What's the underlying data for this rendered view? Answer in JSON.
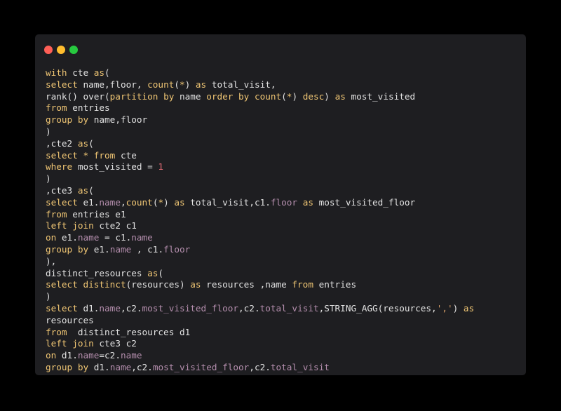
{
  "colors": {
    "background": "#000000",
    "window": "#1e1e21",
    "plain": "#e2e2e2",
    "keyword": "#f0c674",
    "property": "#b48ead",
    "string": "#d19a66",
    "number": "#e06c75",
    "dot_close": "#ff5f56",
    "dot_minimize": "#ffbd2e",
    "dot_zoom": "#27c93f"
  },
  "window_controls": [
    "close-dot",
    "minimize-dot",
    "zoom-dot"
  ],
  "code_lines": [
    [
      [
        "k",
        "with"
      ],
      [
        "p",
        " cte "
      ],
      [
        "k",
        "as"
      ],
      [
        "p",
        "("
      ]
    ],
    [
      [
        "k",
        "select"
      ],
      [
        "p",
        " name,floor, "
      ],
      [
        "k",
        "count"
      ],
      [
        "p",
        "("
      ],
      [
        "k",
        "*"
      ],
      [
        "p",
        ") "
      ],
      [
        "k",
        "as"
      ],
      [
        "p",
        " total_visit,"
      ]
    ],
    [
      [
        "p",
        "rank() over("
      ],
      [
        "k",
        "partition"
      ],
      [
        "p",
        " "
      ],
      [
        "k",
        "by"
      ],
      [
        "p",
        " name "
      ],
      [
        "k",
        "order"
      ],
      [
        "p",
        " "
      ],
      [
        "k",
        "by"
      ],
      [
        "p",
        " "
      ],
      [
        "k",
        "count"
      ],
      [
        "p",
        "("
      ],
      [
        "k",
        "*"
      ],
      [
        "p",
        ") "
      ],
      [
        "k",
        "desc"
      ],
      [
        "p",
        ") "
      ],
      [
        "k",
        "as"
      ],
      [
        "p",
        " most_visited"
      ]
    ],
    [
      [
        "k",
        "from"
      ],
      [
        "p",
        " entries"
      ]
    ],
    [
      [
        "k",
        "group"
      ],
      [
        "p",
        " "
      ],
      [
        "k",
        "by"
      ],
      [
        "p",
        " name,floor"
      ]
    ],
    [
      [
        "p",
        ")"
      ]
    ],
    [
      [
        "p",
        ",cte2 "
      ],
      [
        "k",
        "as"
      ],
      [
        "p",
        "("
      ]
    ],
    [
      [
        "k",
        "select"
      ],
      [
        "p",
        " "
      ],
      [
        "k",
        "*"
      ],
      [
        "p",
        " "
      ],
      [
        "k",
        "from"
      ],
      [
        "p",
        " cte"
      ]
    ],
    [
      [
        "k",
        "where"
      ],
      [
        "p",
        " most_visited = "
      ],
      [
        "n",
        "1"
      ]
    ],
    [
      [
        "p",
        ")"
      ]
    ],
    [
      [
        "p",
        ",cte3 "
      ],
      [
        "k",
        "as"
      ],
      [
        "p",
        "("
      ]
    ],
    [
      [
        "k",
        "select"
      ],
      [
        "p",
        " e1."
      ],
      [
        "m",
        "name"
      ],
      [
        "p",
        ","
      ],
      [
        "k",
        "count"
      ],
      [
        "p",
        "("
      ],
      [
        "k",
        "*"
      ],
      [
        "p",
        ") "
      ],
      [
        "k",
        "as"
      ],
      [
        "p",
        " total_visit,c1."
      ],
      [
        "m",
        "floor"
      ],
      [
        "p",
        " "
      ],
      [
        "k",
        "as"
      ],
      [
        "p",
        " most_visited_floor"
      ]
    ],
    [
      [
        "k",
        "from"
      ],
      [
        "p",
        " entries e1"
      ]
    ],
    [
      [
        "k",
        "left"
      ],
      [
        "p",
        " "
      ],
      [
        "k",
        "join"
      ],
      [
        "p",
        " cte2 c1"
      ]
    ],
    [
      [
        "k",
        "on"
      ],
      [
        "p",
        " e1."
      ],
      [
        "m",
        "name"
      ],
      [
        "p",
        " = c1."
      ],
      [
        "m",
        "name"
      ]
    ],
    [
      [
        "k",
        "group"
      ],
      [
        "p",
        " "
      ],
      [
        "k",
        "by"
      ],
      [
        "p",
        " e1."
      ],
      [
        "m",
        "name"
      ],
      [
        "p",
        " , c1."
      ],
      [
        "m",
        "floor"
      ]
    ],
    [
      [
        "p",
        "),"
      ]
    ],
    [
      [
        "p",
        "distinct_resources "
      ],
      [
        "k",
        "as"
      ],
      [
        "p",
        "("
      ]
    ],
    [
      [
        "k",
        "select"
      ],
      [
        "p",
        " "
      ],
      [
        "k",
        "distinct"
      ],
      [
        "p",
        "(resources) "
      ],
      [
        "k",
        "as"
      ],
      [
        "p",
        " resources ,name "
      ],
      [
        "k",
        "from"
      ],
      [
        "p",
        " entries"
      ]
    ],
    [
      [
        "p",
        ")"
      ]
    ],
    [
      [
        "k",
        "select"
      ],
      [
        "p",
        " d1."
      ],
      [
        "m",
        "name"
      ],
      [
        "p",
        ",c2."
      ],
      [
        "m",
        "most_visited_floor"
      ],
      [
        "p",
        ",c2."
      ],
      [
        "m",
        "total_visit"
      ],
      [
        "p",
        ",STRING_AGG(resources,"
      ],
      [
        "s",
        "','"
      ],
      [
        "p",
        ") "
      ],
      [
        "k",
        "as"
      ]
    ],
    [
      [
        "p",
        "resources"
      ]
    ],
    [
      [
        "k",
        "from"
      ],
      [
        "p",
        "  distinct_resources d1"
      ]
    ],
    [
      [
        "k",
        "left"
      ],
      [
        "p",
        " "
      ],
      [
        "k",
        "join"
      ],
      [
        "p",
        " cte3 c2"
      ]
    ],
    [
      [
        "k",
        "on"
      ],
      [
        "p",
        " d1."
      ],
      [
        "m",
        "name"
      ],
      [
        "p",
        "=c2."
      ],
      [
        "m",
        "name"
      ]
    ],
    [
      [
        "k",
        "group"
      ],
      [
        "p",
        " "
      ],
      [
        "k",
        "by"
      ],
      [
        "p",
        " d1."
      ],
      [
        "m",
        "name"
      ],
      [
        "p",
        ",c2."
      ],
      [
        "m",
        "most_visited_floor"
      ],
      [
        "p",
        ",c2."
      ],
      [
        "m",
        "total_visit"
      ]
    ]
  ]
}
